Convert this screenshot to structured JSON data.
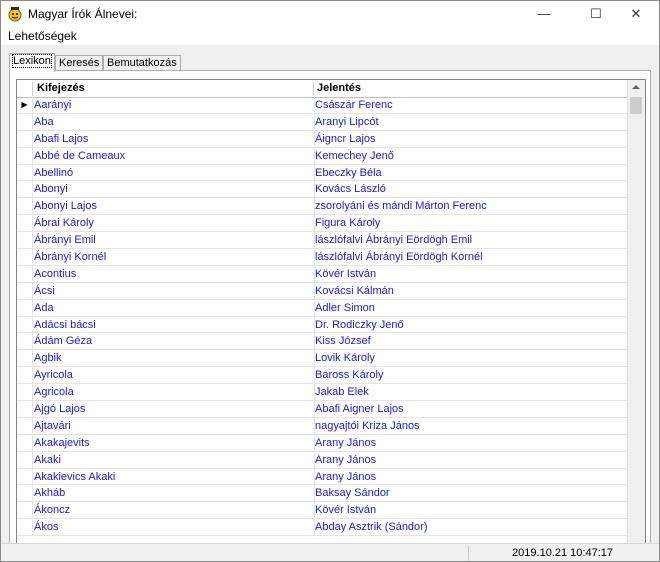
{
  "window": {
    "title": "Magyar Írók Álnevei:",
    "minimize_glyph": "—",
    "maximize_glyph": "☐",
    "close_glyph": "✕"
  },
  "menu": {
    "options_label": "Lehetőségek"
  },
  "tabs": [
    {
      "label": "Lexikon"
    },
    {
      "label": "Keresés"
    },
    {
      "label": "Bemutatkozás"
    }
  ],
  "grid": {
    "col1_header": "Kifejezés",
    "col2_header": "Jelentés",
    "current_row_marker": "▶",
    "rows": [
      {
        "expr": "Aarányi",
        "meaning": "Császár Ferenc"
      },
      {
        "expr": "Aba",
        "meaning": "Aranyi Lipcót"
      },
      {
        "expr": "Abafi Lajos",
        "meaning": "Áigncr Lajos"
      },
      {
        "expr": "Abbé de Cameaux",
        "meaning": "Kemechey Jenő"
      },
      {
        "expr": "Abellinó",
        "meaning": "Ebeczky Béla"
      },
      {
        "expr": "Abonyi",
        "meaning": "Kovács László"
      },
      {
        "expr": "Abonyi Lajos",
        "meaning": "zsorolyáni és mándi Márton Ferenc"
      },
      {
        "expr": "Ábrai Károly",
        "meaning": "Figura Károly"
      },
      {
        "expr": "Ábrányi Emil",
        "meaning": "lászlófalvi Ábrányi Eördögh Emil"
      },
      {
        "expr": "Ábrányi Kornél",
        "meaning": "lászlófalvi Ábrányi Eördögh Kornél"
      },
      {
        "expr": "Acontius",
        "meaning": "Kövér István"
      },
      {
        "expr": "Ácsi",
        "meaning": "Kovácsi Kálmán"
      },
      {
        "expr": "Ada",
        "meaning": "Adler Simon"
      },
      {
        "expr": "Adácsi bácsi",
        "meaning": "Dr. Rodiczky Jenő"
      },
      {
        "expr": "Ádám Géza",
        "meaning": "Kiss József"
      },
      {
        "expr": "Agbik",
        "meaning": "Lovik Károly"
      },
      {
        "expr": "Ayricola",
        "meaning": "Baross Károly"
      },
      {
        "expr": "Agricola",
        "meaning": "Jakab Elek"
      },
      {
        "expr": "Ajgó Lajos",
        "meaning": "Abafi Aigner Lajos"
      },
      {
        "expr": "Ajtavári",
        "meaning": "nagyajtói Kriza János"
      },
      {
        "expr": "Akakajevits",
        "meaning": "Arany János"
      },
      {
        "expr": "Akaki",
        "meaning": "Arany János"
      },
      {
        "expr": "Akakievics Akaki",
        "meaning": "Arany János"
      },
      {
        "expr": "Akháb",
        "meaning": "Baksay Sándor"
      },
      {
        "expr": "Ákoncz",
        "meaning": "Kövér István"
      },
      {
        "expr": "Ákos",
        "meaning": "Abday Asztrik (Sándor)"
      }
    ]
  },
  "status": {
    "datetime": "2019.10.21 10:47:17"
  },
  "colors": {
    "cell_text": "#1a1ad2",
    "app_icon": "#f5c518"
  }
}
